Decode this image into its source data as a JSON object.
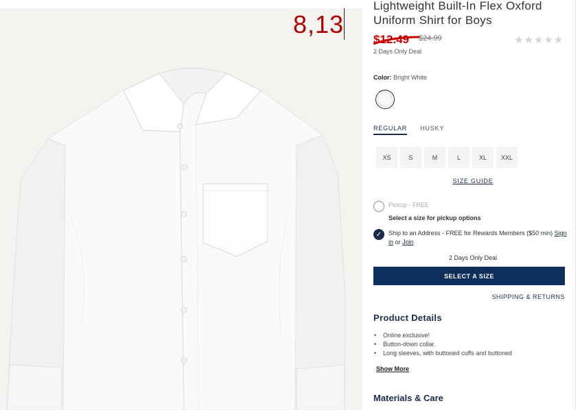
{
  "overlay": {
    "annotation_text": "8,13"
  },
  "product": {
    "title_line1": "Lightweight Built-In Flex Oxford",
    "title_line2": "Uniform Shirt for Boys",
    "sale_price": "$12.49",
    "original_price": "$24.99",
    "rating_stars": "★★★★★",
    "deal_note": "2 Days Only Deal"
  },
  "color": {
    "label": "Color:",
    "value": "Bright White",
    "swatch_color": "#f8f8f8"
  },
  "fit_tabs": [
    {
      "label": "REGULAR",
      "active": true
    },
    {
      "label": "HUSKY",
      "active": false
    }
  ],
  "sizes": [
    "XS",
    "S",
    "M",
    "L",
    "XL",
    "XXL"
  ],
  "size_guide": "SIZE GUIDE",
  "shipping": {
    "pickup_label": "Pickup - FREE",
    "pickup_sub": "Select a size for pickup options",
    "ship_label": "Ship to an Address - FREE for Rewards Members ($50 min)",
    "sign_in": "Sign in",
    "or": "or",
    "join": "Join",
    "deal_center": "2 Days Only Deal"
  },
  "select_button": "SELECT A SIZE",
  "shipping_returns": "SHIPPING & RETURNS",
  "details": {
    "heading": "Product Details",
    "bullets": [
      "Online exclusive!",
      "Button-down collar.",
      "Long sleeves, with buttoned cuffs and buttoned"
    ],
    "show_more": "Show More"
  },
  "materials_heading": "Materials & Care",
  "colors": {
    "navy": "#1a2b4c",
    "button": "#0e2e5c",
    "sale_red": "#cc0000",
    "annotation_red": "#b00000"
  }
}
